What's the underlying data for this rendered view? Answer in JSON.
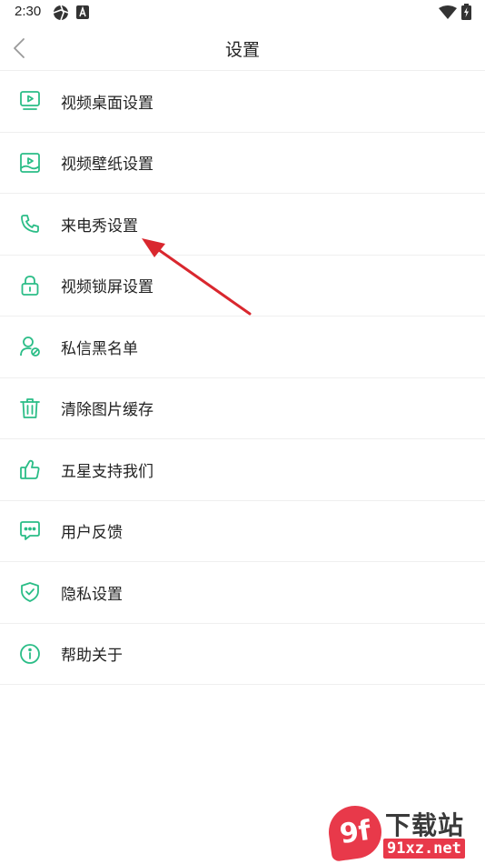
{
  "status_bar": {
    "time": "2:30",
    "left_icons": [
      "aperture-icon",
      "a-box-icon"
    ],
    "right_icons": [
      "wifi-icon",
      "battery-charging-icon"
    ]
  },
  "header": {
    "title": "设置",
    "back_icon": "chevron-left-icon"
  },
  "colors": {
    "accent": "#2bbd87",
    "text": "#222222",
    "divider": "#efefef",
    "annotation_arrow": "#d9272e",
    "watermark": "#e8394a"
  },
  "settings": {
    "items": [
      {
        "label": "视频桌面设置",
        "icon": "video-desktop-icon"
      },
      {
        "label": "视频壁纸设置",
        "icon": "wallpaper-icon"
      },
      {
        "label": "来电秀设置",
        "icon": "phone-icon"
      },
      {
        "label": "视频锁屏设置",
        "icon": "lock-icon"
      },
      {
        "label": "私信黑名单",
        "icon": "user-block-icon"
      },
      {
        "label": "清除图片缓存",
        "icon": "trash-icon"
      },
      {
        "label": "五星支持我们",
        "icon": "thumbs-up-icon"
      },
      {
        "label": "用户反馈",
        "icon": "chat-icon"
      },
      {
        "label": "隐私设置",
        "icon": "shield-check-icon"
      },
      {
        "label": "帮助关于",
        "icon": "info-icon"
      }
    ]
  },
  "watermark": {
    "badge": "9f",
    "title": "下载站",
    "url": "91xz.net"
  }
}
